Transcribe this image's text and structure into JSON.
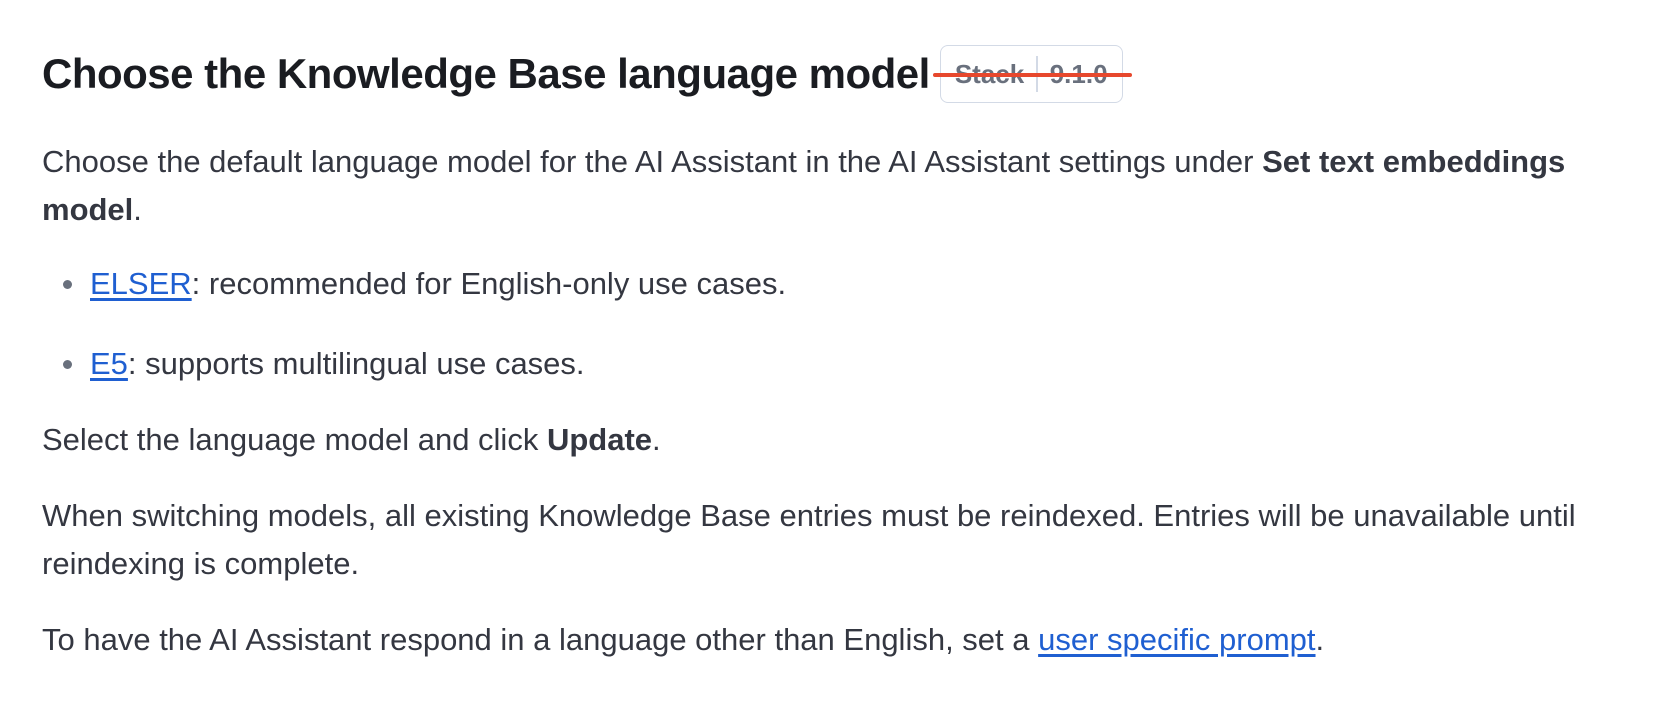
{
  "heading": {
    "title": "Choose the Knowledge Base language model",
    "badge": {
      "product": "Stack",
      "version": "9.1.0",
      "struck_through": true,
      "strike_color": "#e7482d"
    }
  },
  "intro": {
    "text_before": "Choose the default language model for the AI Assistant in the AI Assistant settings under ",
    "bold": "Set text embeddings model",
    "text_after": "."
  },
  "list": {
    "items": [
      {
        "link": "ELSER",
        "text": ": recommended for English-only use cases."
      },
      {
        "link": "E5",
        "text": ": supports multilingual use cases."
      }
    ]
  },
  "select_para": {
    "text_before": "Select the language model and click ",
    "bold": "Update",
    "text_after": "."
  },
  "switching_para": {
    "text": "When switching models, all existing Knowledge Base entries must be reindexed. Entries will be unavailable until reindexing is complete."
  },
  "language_para": {
    "text_before": "To have the AI Assistant respond in a language other than English, set a ",
    "link": "user specific prompt",
    "text_after": "."
  },
  "colors": {
    "link": "#1f5fd1",
    "body_text": "#343741",
    "heading_text": "#1a1c21"
  }
}
